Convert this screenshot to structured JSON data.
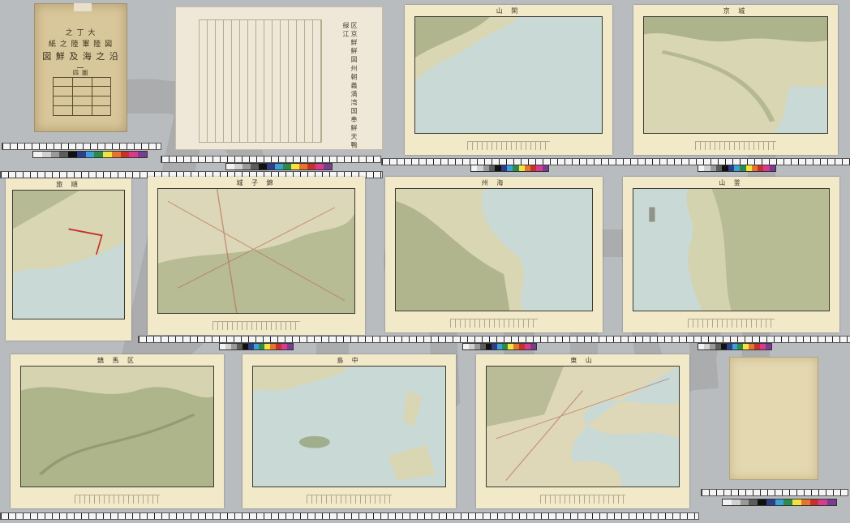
{
  "cover": {
    "lines": [
      "之 丁 大",
      "紙 之 陸 軍 陸 図",
      "図 鮮 及 海 之 沿"
    ],
    "number": "一",
    "sub": "四 圖"
  },
  "index_sheet": {
    "text": "区 京 鮮 鮮 図 州 朝 義 満 湾 国 奉 鮮 天 鴨 緑 江"
  },
  "sheets": [
    {
      "no": "",
      "title": "山 閑"
    },
    {
      "no": "",
      "title": "京 城"
    },
    {
      "no": "",
      "title": "旅 順"
    },
    {
      "no": "",
      "title": "城 子 錦"
    },
    {
      "no": "",
      "title": "州 海"
    },
    {
      "no": "",
      "title": "山 釜"
    },
    {
      "no": "",
      "title": "鎮 馬 区"
    },
    {
      "no": "",
      "title": "島 中"
    },
    {
      "no": "",
      "title": "東 山"
    }
  ],
  "colors": {
    "paper": "#f1e9c8",
    "sea": "#c9d9d6",
    "land": "#d9d6b4",
    "relief": "#8f9b6e",
    "ink": "#3c3a33"
  },
  "colorbar": [
    "#f2f2f2",
    "#d0d0d0",
    "#9a9a9a",
    "#5c5c5c",
    "#111111",
    "#2c3f8a",
    "#3aa0d5",
    "#2c8a4a",
    "#f5e23b",
    "#e6752c",
    "#c9302c",
    "#d93a8f",
    "#7a3c8f"
  ],
  "watermark": "Digital"
}
